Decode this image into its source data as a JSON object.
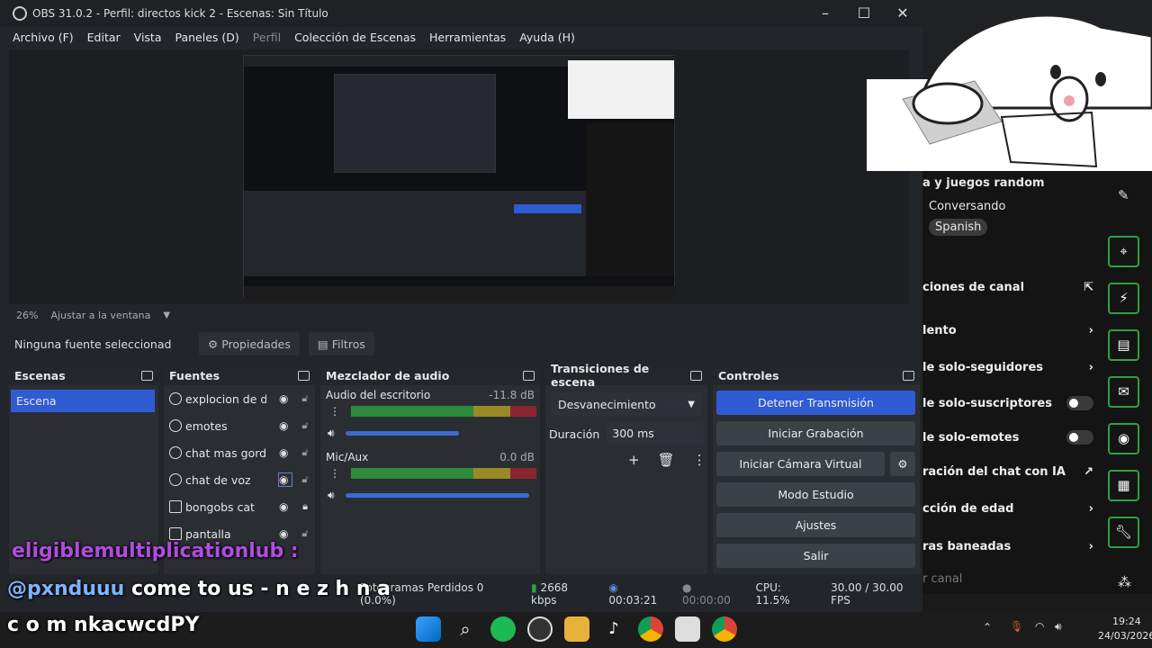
{
  "window": {
    "title": "OBS 31.0.2 - Perfil: directos kick 2 - Escenas: Sin Título"
  },
  "menu": [
    "Archivo (F)",
    "Editar",
    "Vista",
    "Paneles (D)",
    "Perfil",
    "Colección de Escenas",
    "Herramientas",
    "Ayuda (H)"
  ],
  "preview": {
    "zoom": "26%",
    "fit_label": "Ajustar a la ventana"
  },
  "toolbar": {
    "no_source": "Ninguna fuente seleccionad",
    "properties": "Propiedades",
    "filters": "Filtros"
  },
  "scenes": {
    "header": "Escenas",
    "items": [
      "Escena"
    ]
  },
  "sources": {
    "header": "Fuentes",
    "items": [
      "explocion de dc",
      "emotes",
      "chat mas gordo",
      "chat de voz",
      "bongobs cat",
      "pantalla"
    ]
  },
  "mixer": {
    "header": "Mezclador de audio",
    "channels": [
      {
        "name": "Audio del escritorio",
        "db": "-11.8 dB",
        "level": 0.75
      },
      {
        "name": "Mic/Aux",
        "db": "0.0 dB",
        "level": 1.0
      }
    ],
    "scale": [
      "-60",
      "-55",
      "-50",
      "-45",
      "-40",
      "-35",
      "-30",
      "-25",
      "-20",
      "-15",
      "-10",
      "-5",
      "0"
    ]
  },
  "transitions": {
    "header": "Transiciones de escena",
    "type": "Desvanecimiento",
    "duration_label": "Duración",
    "duration_value": "300 ms"
  },
  "controls": {
    "header": "Controles",
    "buttons": [
      "Detener Transmisión",
      "Iniciar Grabación",
      "Iniciar Cámara Virtual",
      "Modo Estudio",
      "Ajustes",
      "Salir"
    ]
  },
  "status": {
    "dropped": "Fotogramas Perdidos 0 (0.0%)",
    "bitrate": "2668 kbps",
    "live_time": "00:03:21",
    "rec_time": "00:00:00",
    "cpu": "CPU: 11.5%",
    "fps": "30.00 / 30.00 FPS"
  },
  "chat": {
    "title_partial": "a y juegos random",
    "conversing": "Conversando",
    "language_tag": "Spanish",
    "section": "ciones de canal",
    "rows": [
      "lento",
      "le solo-seguidores",
      "le solo-suscriptores",
      "le solo-emotes",
      "ración del chat con IA",
      "cción de edad",
      "ras baneadas",
      "r canal"
    ]
  },
  "overlay": {
    "line1": "eligiblemultiplicationlub :",
    "line2_user": "@pxnduuu",
    "line2_msg": "come to us - n e z h n a",
    "line3": "c o m nkacwcdPY"
  },
  "taskbar": {
    "time": "19:24",
    "date": "24/03/2026"
  },
  "colors": {
    "accent": "#2f5bd3",
    "green": "#2ea043",
    "purple_text": "#b04de0"
  }
}
